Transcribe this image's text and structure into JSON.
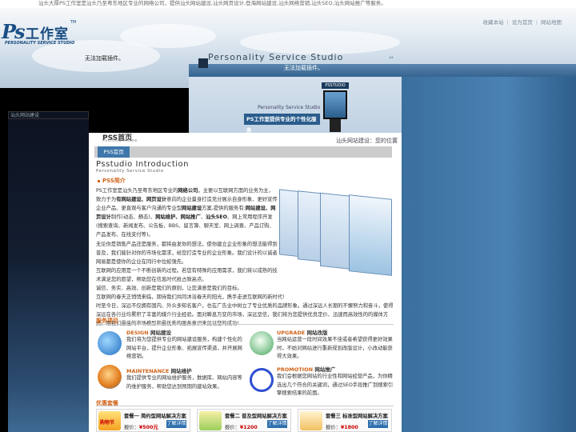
{
  "top_line": "汕头大厚PS工作室是汕头乃至粤东地区专业的网络公司，提供汕头网站建设,汕头网页设计,登海网站建设,汕头网络营销,汕头SEO,汕头网站推广等服务。",
  "top_links": [
    "收藏本站",
    "设为首页",
    "网站地图"
  ],
  "logo": {
    "ps": "Ps",
    "cn": "工作室",
    "tm": "TM",
    "sub": "PERSONALITY SERVICE STUDIO"
  },
  "banner": {
    "plugin_msg_1": "无法加载插件。",
    "studio_title": "Personality Service Studio",
    "plugin_msg_2": "无法加载插件。",
    "arrow": "⇔",
    "kiosk_label": "PSSTUDIO",
    "pss_label": "Personality Service Studio",
    "slogan": "PS工作室提供专业的个性化服务"
  },
  "left_image_alt": "汕头网站建设",
  "breadcrumb": {
    "title": "PSS首页",
    "subtitle": "Psstudio Home",
    "location": "汕头网站建设：您的位置"
  },
  "tab": "PSS首页",
  "intro": {
    "title": "Psstudio Introduction",
    "subtitle": "Personality Service Studio",
    "heading": "PSS简介",
    "p1_a": "PS工作室是汕头乃至粤东地区专业的",
    "p1_b": "网络公司",
    "p1_c": "。主要以互联网方面的业务为主，致力于为",
    "p1_d": "有网站建设、网页设计",
    "p1_e": "意向的企业量身打造充分展示自身形象、更好宣传企业产品、更直观与客户沟通的专业型",
    "p1_f": "网站建设",
    "p1_g": "方案,提供的服务有:",
    "p1_h": "网站建设、网页设计",
    "p1_i": "制作(动态、静态)、",
    "p1_j": "网站维护、网站推广",
    "p1_k": "、",
    "p1_l": "汕头SEO",
    "p1_m": "、网上常用程序开发(搜索查询、新闻发布、公告板、BBS、留言簿、聊天室、网上调查、产品订购、产品发布、在线支付等)。",
    "p1_n": "无论你是销售产品还是服务，都将由发你的想法，使你建立企业形象的想法能得到普及，我们能针对你的市场化需求，给您打造专业的企业形象。我们设计的以诚者网易都是使你的企业在同行中位蛟强先。",
    "p1_o": "互联网的应用是一个不断创新的过程。若您有特殊的应用需求，我们将以成熟的技术满足您的愿望，帮助您在信息时代抢占致高点。",
    "p2_a": "诚信、务实、高效、创新是我们的原则，让您满意是我们的目标。",
    "p2_b": "互联网的春天正悄悄来临，期待我们共同沐浴春天的阳光，携手走进互联网的新时代!",
    "p2_c": "时至今日，深远不仅拥有国内、外众多知名客户，也在广告业中树立了专业优质的品牌形象。通过深远人长期的不懈努力和奋斗，使得深远在各行业均累积了丰富的媒介行业经验。面对瞬息万变的市场，深远坚信，我们将为您提供优良定价、迅速而高效性的的媒体方案。用我们最佳的市场模型和最优秀的服务意识来见证您的成功!"
  },
  "services": {
    "heading": "服务项目",
    "items": [
      {
        "en": "DESIGN",
        "cn": "网站建设",
        "desc": "我们将为您提供专业的网站建设服务，构建个性化的网站平台，提升企业形象、拓展宣传渠道，并开展网络营销。"
      },
      {
        "en": "UPGRADE",
        "cn": "网站改版",
        "desc": "当网站运营一段时间效果不佳或者希望获得更好效果时，不妨对网站进行重新规划改版设计，小改动能获得大效果。"
      },
      {
        "en": "MAINTENANCE",
        "cn": "网站维护",
        "desc": "我们提供专业的网站维护服务，数据库、网站内容等的维护服务，帮助您达到预期的建站效果。"
      },
      {
        "en": "PROMOTION",
        "cn": "网站推广",
        "desc": "我们会根据您网站的行业性和网站经营产品，为你精选出几个符合的关键词，通过SEO手段推广到搜索引擎搜索结果的前面。"
      }
    ]
  },
  "packages": {
    "heading": "优惠套餐",
    "items": [
      {
        "title": "套餐一 简约型网站解决方案",
        "price_label": "报价：",
        "price": "¥500元",
        "button": "了解详情",
        "img_text": "购物节"
      },
      {
        "title": "套餐二 普及型网站解决方案",
        "price_label": "报价：",
        "price": "¥1200",
        "button": "了解详情",
        "img_text": ""
      },
      {
        "title": "套餐三 标准型网站解决方案",
        "price_label": "报价：",
        "price": "¥1800",
        "button": "了解详情",
        "img_text": ""
      }
    ]
  },
  "colors": {
    "accent_orange": "#d0641a",
    "nav_blue": "#3e77ab",
    "button_blue": "#2e6fad",
    "price_red": "#cc0000"
  }
}
